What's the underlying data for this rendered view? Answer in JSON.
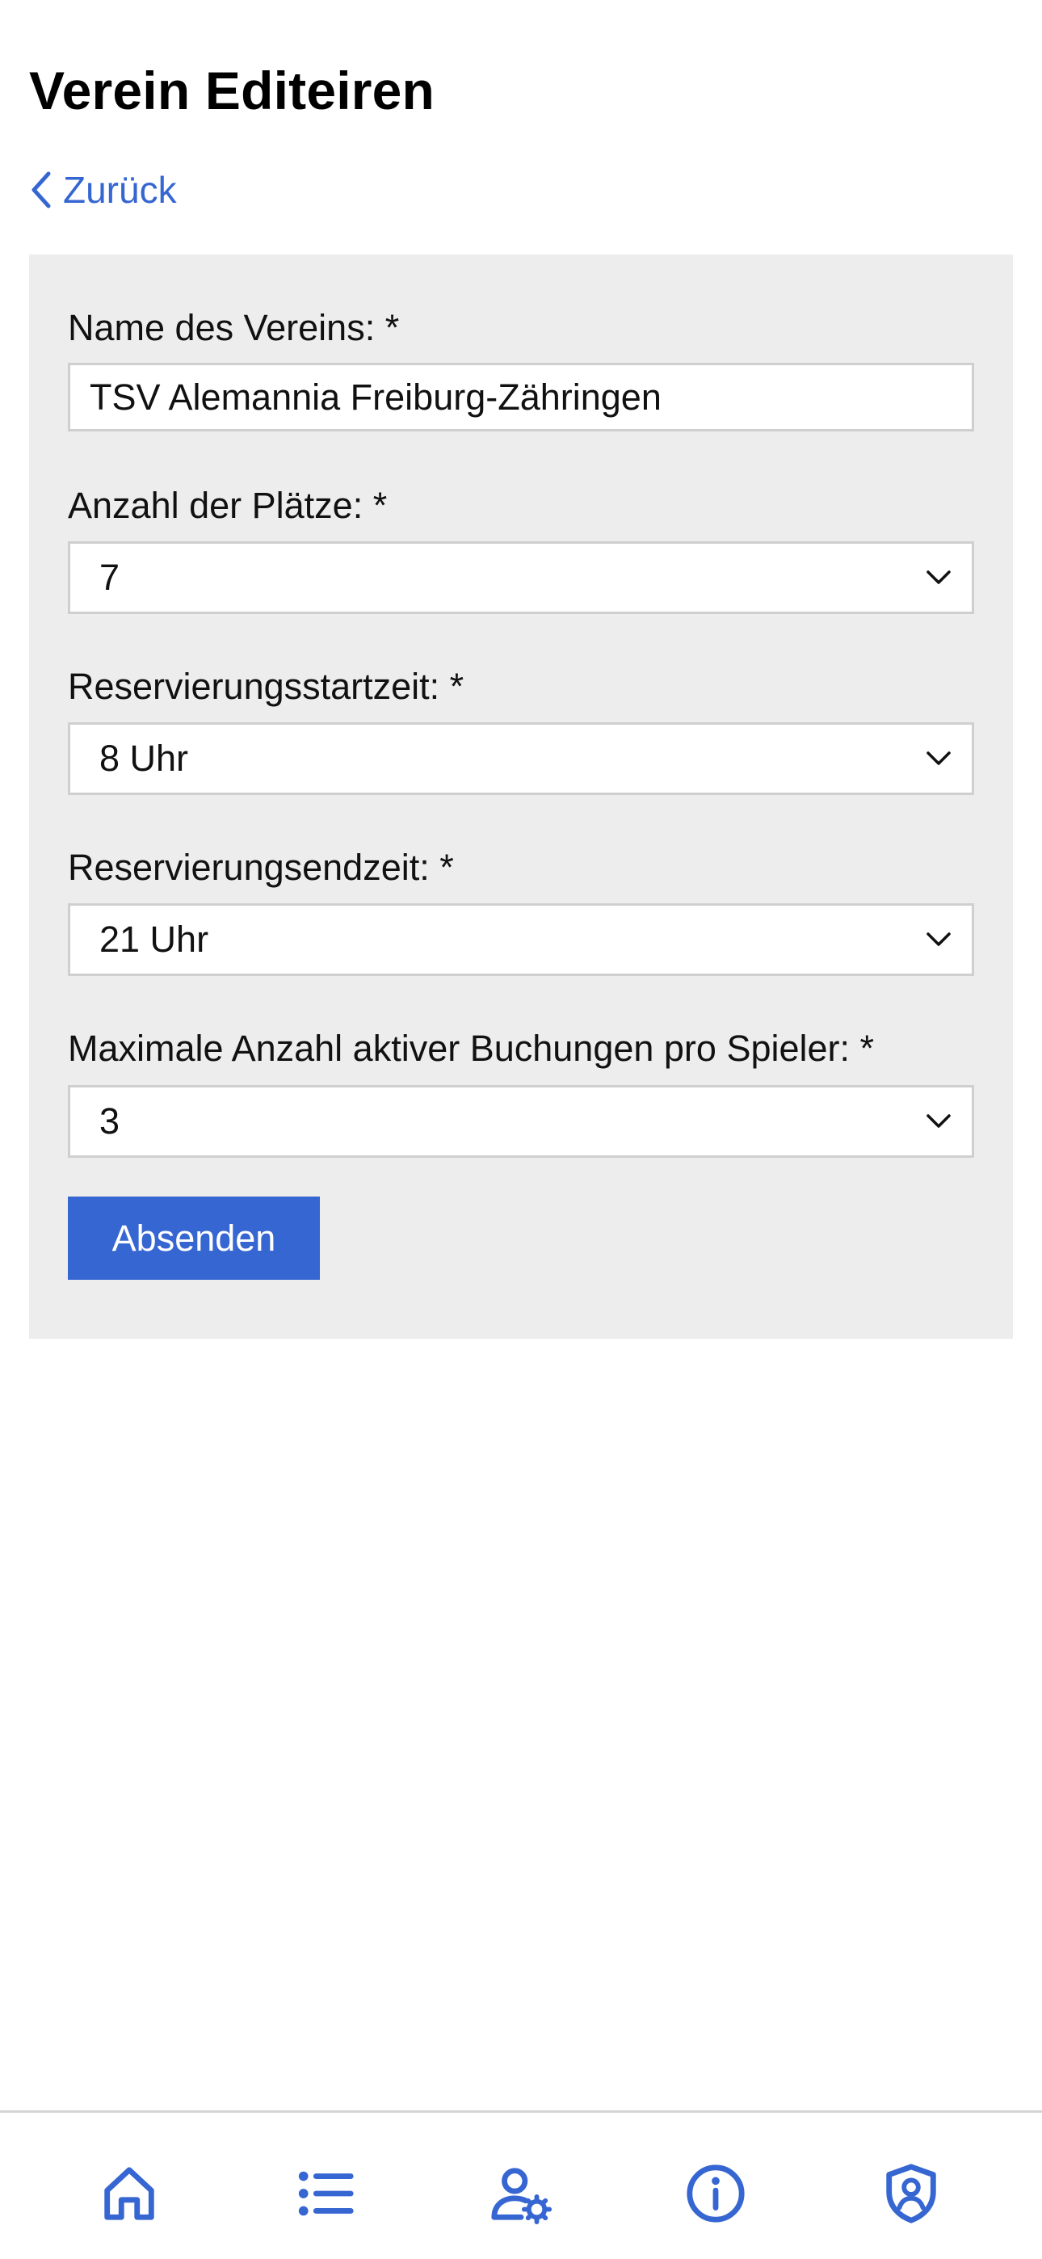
{
  "header": {
    "title": "Verein Editeiren",
    "back_label": "Zurück"
  },
  "form": {
    "club_name": {
      "label": "Name des Vereins: *",
      "value": "TSV Alemannia Freiburg-Zähringen"
    },
    "court_count": {
      "label": "Anzahl der Plätze: *",
      "value": "7"
    },
    "booking_start": {
      "label": "Reservierungsstartzeit: *",
      "value": "8 Uhr"
    },
    "booking_end": {
      "label": "Reservierungsendzeit: *",
      "value": "21 Uhr"
    },
    "max_bookings": {
      "label": "Maximale Anzahl aktiver Buchungen pro Spieler: *",
      "value": "3"
    },
    "submit_label": "Absenden"
  },
  "tab_bar": {
    "items": [
      {
        "icon": "home-icon"
      },
      {
        "icon": "list-icon"
      },
      {
        "icon": "user-settings-icon"
      },
      {
        "icon": "info-icon"
      },
      {
        "icon": "shield-user-icon"
      }
    ]
  },
  "colors": {
    "accent": "#3666d1",
    "card_background": "#ededed",
    "input_border": "#cfcfcf"
  }
}
